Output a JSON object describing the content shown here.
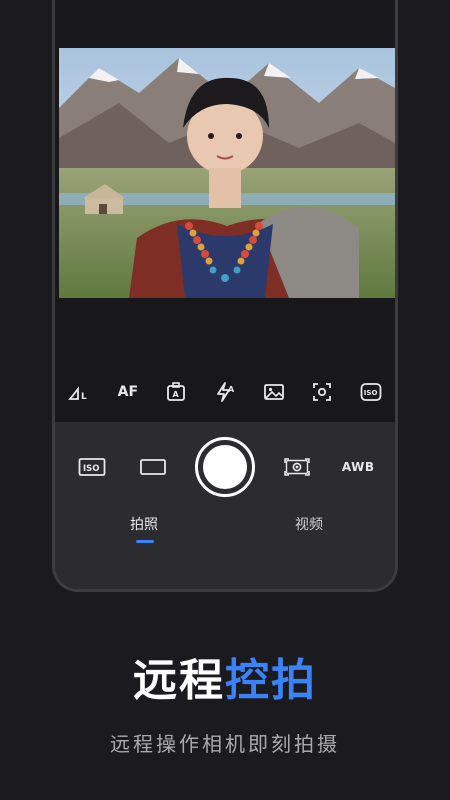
{
  "camera": {
    "toolbar": [
      {
        "icon": "aspect-ratio-icon",
        "label": "L"
      },
      {
        "icon": "autofocus-icon",
        "label": "AF"
      },
      {
        "icon": "auto-exposure-icon",
        "label": "A"
      },
      {
        "icon": "flash-auto-icon",
        "label": "A"
      },
      {
        "icon": "gallery-icon",
        "label": ""
      },
      {
        "icon": "focus-frame-icon",
        "label": ""
      },
      {
        "icon": "iso-icon",
        "label": "ISO"
      }
    ],
    "controls": {
      "iso_label": "ISO",
      "awb_label": "AWB"
    },
    "modes": {
      "photo": "拍照",
      "video": "视频",
      "active": "photo"
    },
    "accent_color": "#3a82f7"
  },
  "promo": {
    "title_white": "远程",
    "title_blue": "控拍",
    "subtitle": "远程操作相机即刻拍摄"
  }
}
